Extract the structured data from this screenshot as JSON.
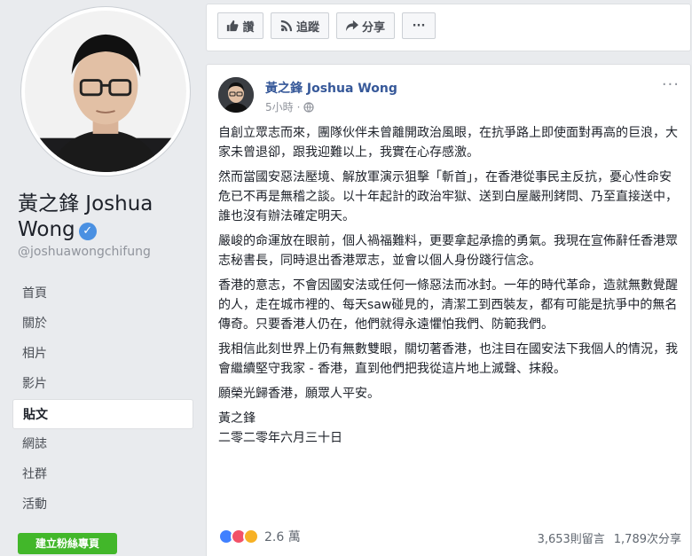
{
  "profile": {
    "name": "黃之鋒 Joshua Wong",
    "handle": "@joshuawongchifung"
  },
  "nav": [
    {
      "label": "首頁",
      "active": false
    },
    {
      "label": "關於",
      "active": false
    },
    {
      "label": "相片",
      "active": false
    },
    {
      "label": "影片",
      "active": false
    },
    {
      "label": "貼文",
      "active": true
    },
    {
      "label": "網誌",
      "active": false
    },
    {
      "label": "社群",
      "active": false
    },
    {
      "label": "活動",
      "active": false
    }
  ],
  "create_page_label": "建立粉絲專頁",
  "actions": {
    "like": "讚",
    "follow": "追蹤",
    "share": "分享",
    "more": "···"
  },
  "post": {
    "author": "黃之鋒 Joshua Wong",
    "time": "5小時",
    "paragraphs": [
      "自創立眾志而來，團隊伙伴未曾離開政治風眼，在抗爭路上即使面對再高的巨浪，大家未曾退卻，跟我迎難以上，我實在心存感激。",
      "然而當國安惡法壓境、解放軍演示狙擊「斬首」，在香港從事民主反抗，憂心性命安危已不再是無稽之談。以十年起計的政治牢獄、送到白屋嚴刑銬問、乃至直接送中，誰也沒有辦法確定明天。",
      "嚴峻的命運放在眼前，個人禍福難料，更要拿起承擔的勇氣。我現在宣佈辭任香港眾志秘書長，同時退出香港眾志，並會以個人身份踐行信念。",
      "香港的意志，不會因國安法或任何一條惡法而冰封。一年的時代革命，造就無數覺醒的人，走在城市裡的、每天saw碰見的，清潔工到西裝友，都有可能是抗爭中的無名傳奇。只要香港人仍在，他們就得永遠懼怕我們、防範我們。",
      "我相信此刻世界上仍有無數雙眼，關切著香港，也注目在國安法下我個人的情況，我會繼續堅守我家 - 香港，直到他們把我從這片地上滅聲、抹殺。",
      "願榮光歸香港，願眾人平安。"
    ],
    "signature": "黃之鋒",
    "date": "二零二零年六月三十日",
    "reaction_count": "2.6 萬",
    "comments": "3,653則留言",
    "shares": "1,789次分享"
  },
  "colors": {
    "background": "#e9ebee",
    "link": "#365899",
    "green": "#42b72a",
    "verified": "#4a90e2"
  }
}
